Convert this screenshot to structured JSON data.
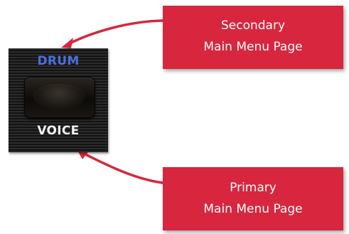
{
  "panel": {
    "top_label": "DRUM",
    "bottom_label": "VOICE",
    "top_label_color": "#4a6fe0",
    "bottom_label_color": "#f2f2f2"
  },
  "callouts": {
    "secondary": {
      "line1": "Secondary",
      "line2": "Main Menu Page"
    },
    "primary": {
      "line1": "Primary",
      "line2": "Main Menu Page"
    },
    "color": "#d7263d",
    "text_color": "#ffffff"
  },
  "arrow_color": "#d7263d"
}
